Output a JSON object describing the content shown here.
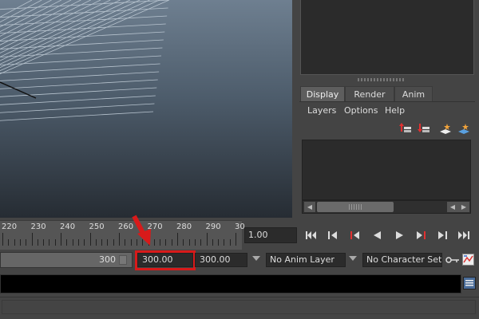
{
  "right_panel": {
    "tabs": [
      {
        "label": "Display",
        "active": true
      },
      {
        "label": "Render",
        "active": false
      },
      {
        "label": "Anim",
        "active": false
      }
    ],
    "menu": [
      "Layers",
      "Options",
      "Help"
    ]
  },
  "time_slider": {
    "labels": [
      "220",
      "230",
      "240",
      "250",
      "260",
      "270",
      "280",
      "290",
      "30"
    ],
    "current_time": "1.00"
  },
  "playback_buttons": [
    "go-to-start",
    "step-back-key",
    "step-back-frame",
    "play-backwards",
    "play-forwards",
    "step-forward-frame",
    "step-forward-key",
    "go-to-end"
  ],
  "range_slider": {
    "value": "300",
    "end_time": "300.00",
    "playback_end": "300.00"
  },
  "anim_layer": {
    "selected": "No Anim Layer"
  },
  "character_set": {
    "selected": "No Character Set"
  },
  "colors": {
    "highlight": "#d81a1a",
    "panel_bg": "#444444",
    "field_bg": "#2b2b2b",
    "viewport_top": "#6e7f90",
    "viewport_bottom": "#262c33"
  }
}
